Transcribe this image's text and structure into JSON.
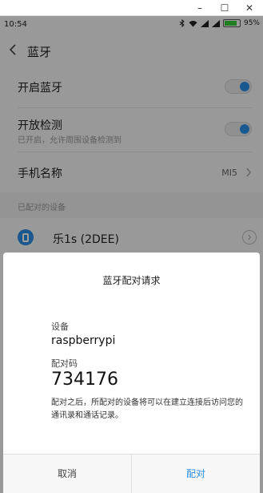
{
  "window": {
    "minimize_glyph": "–",
    "maximize_glyph": "☐",
    "close_glyph": "✕"
  },
  "status_bar": {
    "time": "10:54",
    "battery_percent_text": "95%",
    "battery_level": 0.95,
    "icons": [
      "bluetooth-icon",
      "wifi-icon",
      "signal-icon",
      "signal-icon",
      "battery-icon"
    ]
  },
  "header": {
    "title": "蓝牙"
  },
  "settings": {
    "bluetooth_toggle": {
      "label": "开启蓝牙",
      "enabled": true
    },
    "visibility": {
      "label": "开放检测",
      "subtext": "已开启，允许周围设备检测到",
      "enabled": true
    },
    "device_name": {
      "label": "手机名称",
      "value": "MI5"
    },
    "paired_section_label": "已配对的设备",
    "paired_devices": [
      {
        "name": "乐1s (2DEE)"
      }
    ]
  },
  "dialog": {
    "title": "蓝牙配对请求",
    "device_label": "设备",
    "device_value": "raspberrypi",
    "code_label": "配对码",
    "code_value": "734176",
    "note": "配对之后，所配对的设备将可以在建立连接后访问您的通讯录和通话记录。",
    "cancel_label": "取消",
    "confirm_label": "配对"
  },
  "colors": {
    "accent": "#2a8ee8"
  }
}
